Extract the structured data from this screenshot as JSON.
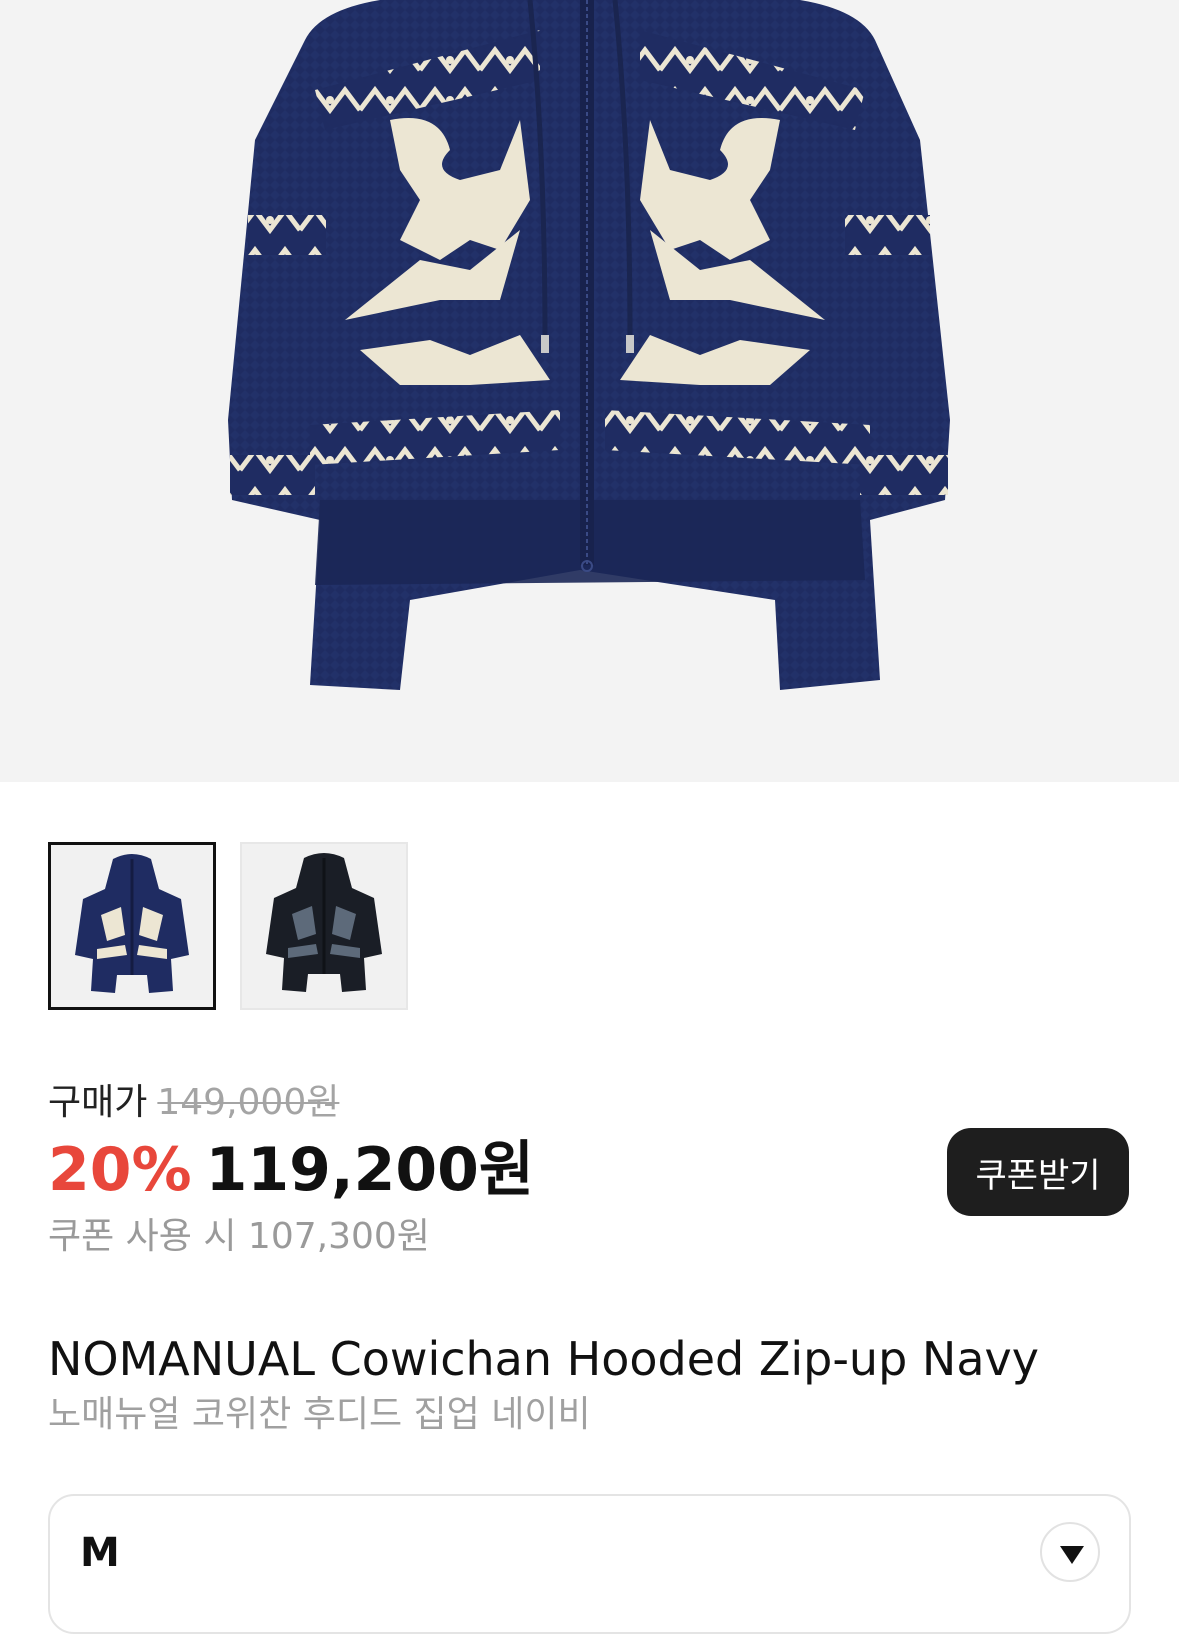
{
  "product": {
    "title_en": "NOMANUAL Cowichan Hooded Zip-up Navy",
    "title_ko": "노매뉴얼 코위찬 후디드 집업 네이비",
    "image_alt": "Cowichan hooded zip-up knit jacket"
  },
  "thumbnails": [
    {
      "label": "Navy",
      "selected": true
    },
    {
      "label": "Black",
      "selected": false
    }
  ],
  "price": {
    "original_label": "구매가",
    "original_price": "149,000원",
    "discount_rate": "20%",
    "sale_price": "119,200원",
    "coupon_note": "쿠폰 사용 시 107,300원"
  },
  "coupon_button": {
    "label": "쿠폰받기"
  },
  "size_select": {
    "value": "M",
    "icon": "chevron-down-icon"
  },
  "colors": {
    "discount": "#e8473b",
    "navy": "#1e2a5e",
    "cream": "#ece6d3",
    "button_bg": "#1e1e1e"
  }
}
